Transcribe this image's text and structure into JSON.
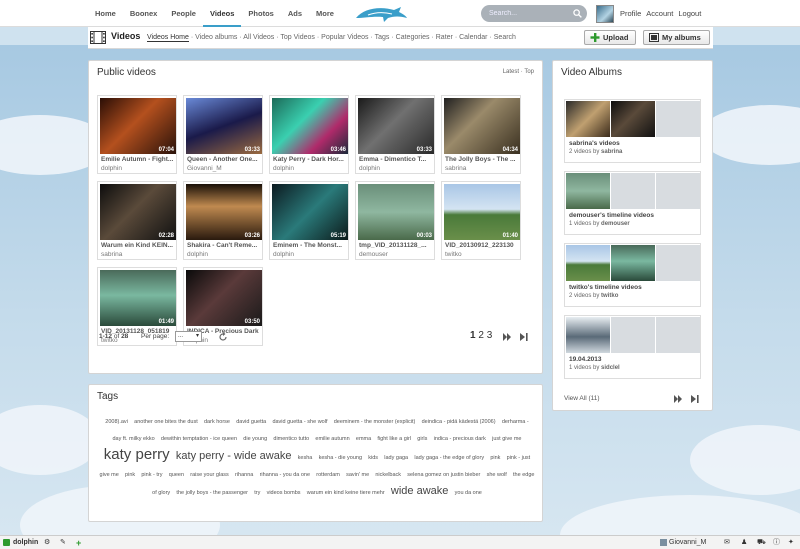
{
  "topnav": {
    "items": [
      "Home",
      "Boonex",
      "People",
      "Videos",
      "Photos",
      "Ads",
      "More"
    ],
    "search_placeholder": "Search...",
    "user_links": [
      "Profile",
      "Account",
      "Logout"
    ]
  },
  "subnav": {
    "title": "Videos",
    "tabs": [
      "Videos Home",
      "Video albums",
      "All Videos",
      "Top Videos",
      "Popular Videos",
      "Tags",
      "Categories",
      "Rater",
      "Calendar",
      "Search"
    ],
    "upload_label": "Upload",
    "albums_label": "My albums"
  },
  "public_videos": {
    "title": "Public videos",
    "sort_latest": "Latest",
    "sort_top": "Top",
    "videos": [
      {
        "title": "Emilie Autumn - Fight...",
        "user": "dolphin",
        "duration": "07:04"
      },
      {
        "title": "Queen - Another One...",
        "user": "Giovanni_M",
        "duration": "03:33"
      },
      {
        "title": "Katy Perry - Dark Hor...",
        "user": "dolphin",
        "duration": "03:46"
      },
      {
        "title": "Emma - Dimentico T...",
        "user": "dolphin",
        "duration": "03:33"
      },
      {
        "title": "The Jolly Boys - The ...",
        "user": "sabrina",
        "duration": "04:34"
      },
      {
        "title": "Warum ein Kind KEIN...",
        "user": "sabrina",
        "duration": "02:28"
      },
      {
        "title": "Shakira - Can't Reme...",
        "user": "dolphin",
        "duration": "03:26"
      },
      {
        "title": "Eminem - The Monst...",
        "user": "dolphin",
        "duration": "05:19"
      },
      {
        "title": "tmp_VID_20131128_...",
        "user": "demouser",
        "duration": "00:03"
      },
      {
        "title": "VID_20130912_223130",
        "user": "twitko",
        "duration": "01:40"
      },
      {
        "title": "VID_20131128_051819",
        "user": "twitko",
        "duration": "01:49"
      },
      {
        "title": "INDICA - Precious Dark",
        "user": "dolphin",
        "duration": "03:50"
      }
    ],
    "pagination": {
      "range": "1-12",
      "of_label": "of",
      "total": "28",
      "per_page_label": "Per page:",
      "per_page_value": "...",
      "pages": [
        "1",
        "2",
        "3"
      ]
    }
  },
  "tags": {
    "title": "Tags",
    "items": [
      {
        "text": "2008).avi",
        "size": "s"
      },
      {
        "text": "another one bites the dust",
        "size": "s"
      },
      {
        "text": "dark horse",
        "size": "s"
      },
      {
        "text": "david guetta",
        "size": "s"
      },
      {
        "text": "david guetta - she wolf",
        "size": "s"
      },
      {
        "text": "deeminem - the monster (explicit)",
        "size": "s"
      },
      {
        "text": "deindica - pidä kädestä (2006)",
        "size": "s"
      },
      {
        "text": "derharma -",
        "size": "s"
      },
      {
        "text": "day ft. milky ekko",
        "size": "s"
      },
      {
        "text": "dewithin temptation - ice queen",
        "size": "s"
      },
      {
        "text": "die young",
        "size": "s"
      },
      {
        "text": "dimentico tutto",
        "size": "s"
      },
      {
        "text": "emilie autumn",
        "size": "s"
      },
      {
        "text": "emma",
        "size": "s"
      },
      {
        "text": "fight like a girl",
        "size": "s"
      },
      {
        "text": "girls",
        "size": "s"
      },
      {
        "text": "indica - precious dark",
        "size": "s"
      },
      {
        "text": "just give me",
        "size": "s"
      },
      {
        "text": "katy perry",
        "size": "xl"
      },
      {
        "text": "katy perry - wide awake",
        "size": "l"
      },
      {
        "text": "kesha",
        "size": "s"
      },
      {
        "text": "kesha - die young",
        "size": "s"
      },
      {
        "text": "kids",
        "size": "s"
      },
      {
        "text": "lady gaga",
        "size": "s"
      },
      {
        "text": "lady gaga - the edge of glory",
        "size": "s"
      },
      {
        "text": "pink",
        "size": "s"
      },
      {
        "text": "pink - just",
        "size": "s"
      },
      {
        "text": "give me",
        "size": "s"
      },
      {
        "text": "pink",
        "size": "s"
      },
      {
        "text": "pink - try",
        "size": "s"
      },
      {
        "text": "queen",
        "size": "s"
      },
      {
        "text": "raise your glass",
        "size": "s"
      },
      {
        "text": "rihanna",
        "size": "s"
      },
      {
        "text": "rihanna - you da one",
        "size": "s"
      },
      {
        "text": "rotterdam",
        "size": "s"
      },
      {
        "text": "savin' me",
        "size": "s"
      },
      {
        "text": "nickelback",
        "size": "s"
      },
      {
        "text": "selena gomez on justin bieber",
        "size": "s"
      },
      {
        "text": "she wolf",
        "size": "s"
      },
      {
        "text": "the edge",
        "size": "s"
      },
      {
        "text": "of glory",
        "size": "s"
      },
      {
        "text": "the jolly boys - the passenger",
        "size": "s"
      },
      {
        "text": "try",
        "size": "s"
      },
      {
        "text": "videos bombs",
        "size": "s"
      },
      {
        "text": "warum ein kind keine tiere mehr",
        "size": "s"
      },
      {
        "text": "wide awake",
        "size": "m"
      },
      {
        "text": "you da one",
        "size": "s"
      }
    ]
  },
  "video_albums": {
    "title": "Video Albums",
    "albums": [
      {
        "title": "sabrina's videos",
        "count": "2 videos by",
        "owner": "sabrina"
      },
      {
        "title": "demouser's timeline videos",
        "count": "1 videos by",
        "owner": "demouser"
      },
      {
        "title": "twitko's timeline videos",
        "count": "2 videos by",
        "owner": "twitko"
      },
      {
        "title": "19.04.2013",
        "count": "1 videos by",
        "owner": "sidclel"
      }
    ],
    "view_all": "View All (11)"
  },
  "bottombar": {
    "username": "dolphin",
    "right_user": "Giovanni_M"
  },
  "colors": {
    "accent": "#3a9ec9",
    "green": "#2e9a2e"
  }
}
